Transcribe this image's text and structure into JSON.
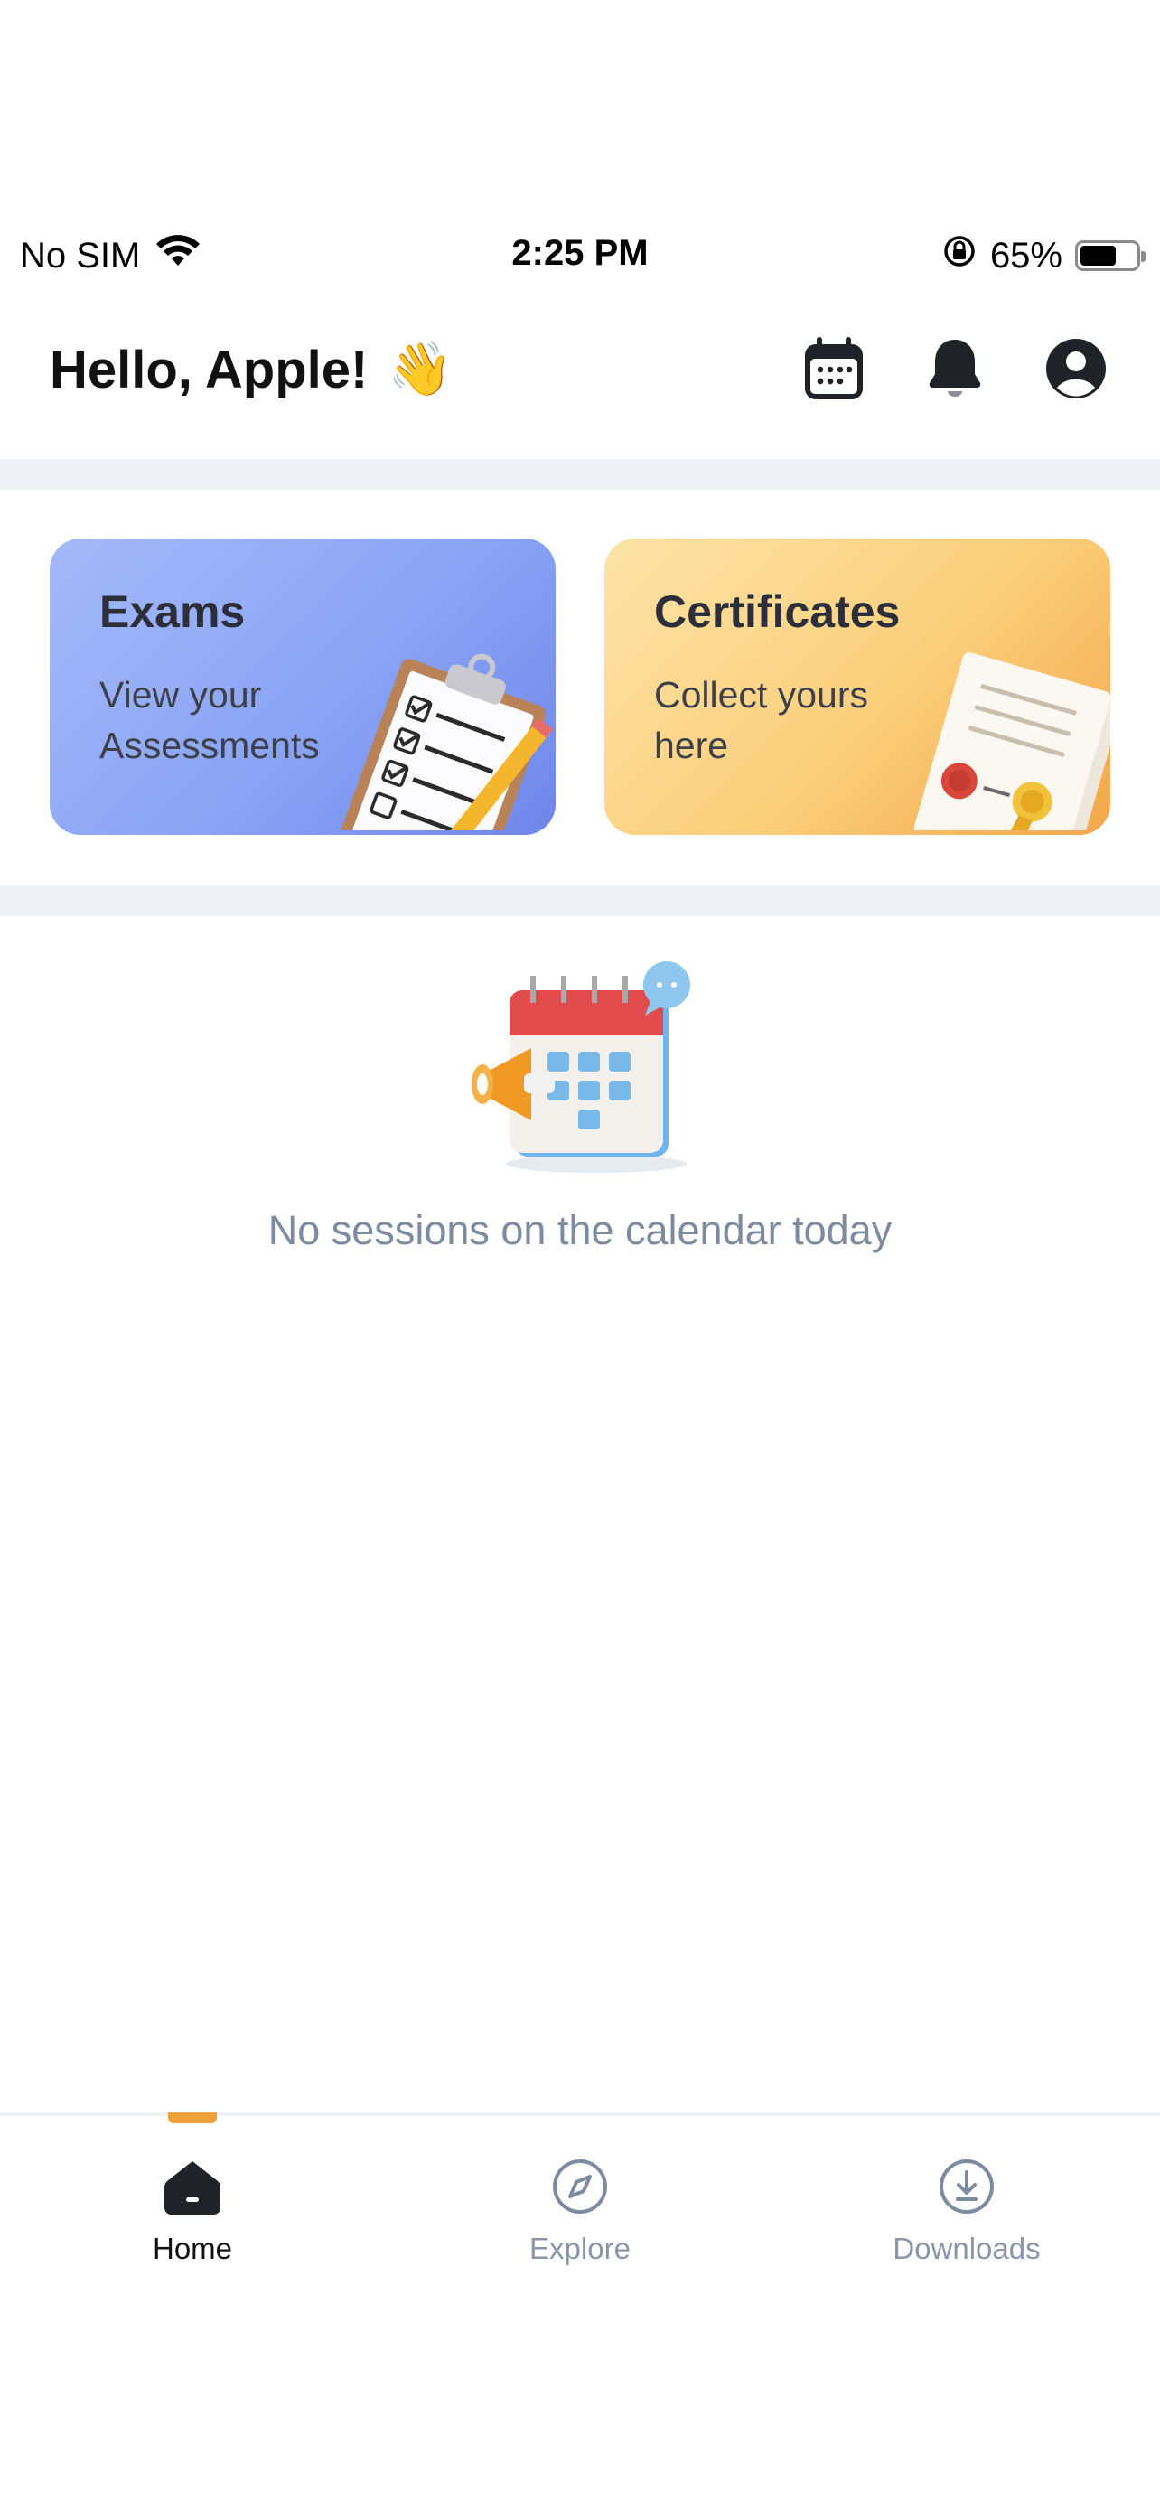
{
  "status_bar": {
    "carrier": "No SIM",
    "time": "2:25 PM",
    "battery_percent": "65%",
    "battery_level": 0.65
  },
  "header": {
    "greeting": "Hello, Apple!",
    "wave_emoji": "👋",
    "icons": [
      "calendar-icon",
      "bell-icon",
      "profile-icon"
    ]
  },
  "cards": {
    "exams": {
      "title": "Exams",
      "subtitle": "View your Assessments"
    },
    "certificates": {
      "title": "Certificates",
      "subtitle": "Collect yours here"
    }
  },
  "empty_state": {
    "message": "No sessions on the calendar today"
  },
  "bottom_nav": {
    "items": [
      {
        "label": "Home",
        "icon": "home-icon",
        "active": true
      },
      {
        "label": "Explore",
        "icon": "compass-icon",
        "active": false
      },
      {
        "label": "Downloads",
        "icon": "download-icon",
        "active": false
      }
    ]
  },
  "colors": {
    "accent": "#f0a23a",
    "exams_card": "#8aa4f5",
    "certificates_card": "#fbcf7b",
    "muted_text": "#7d8ba0"
  }
}
